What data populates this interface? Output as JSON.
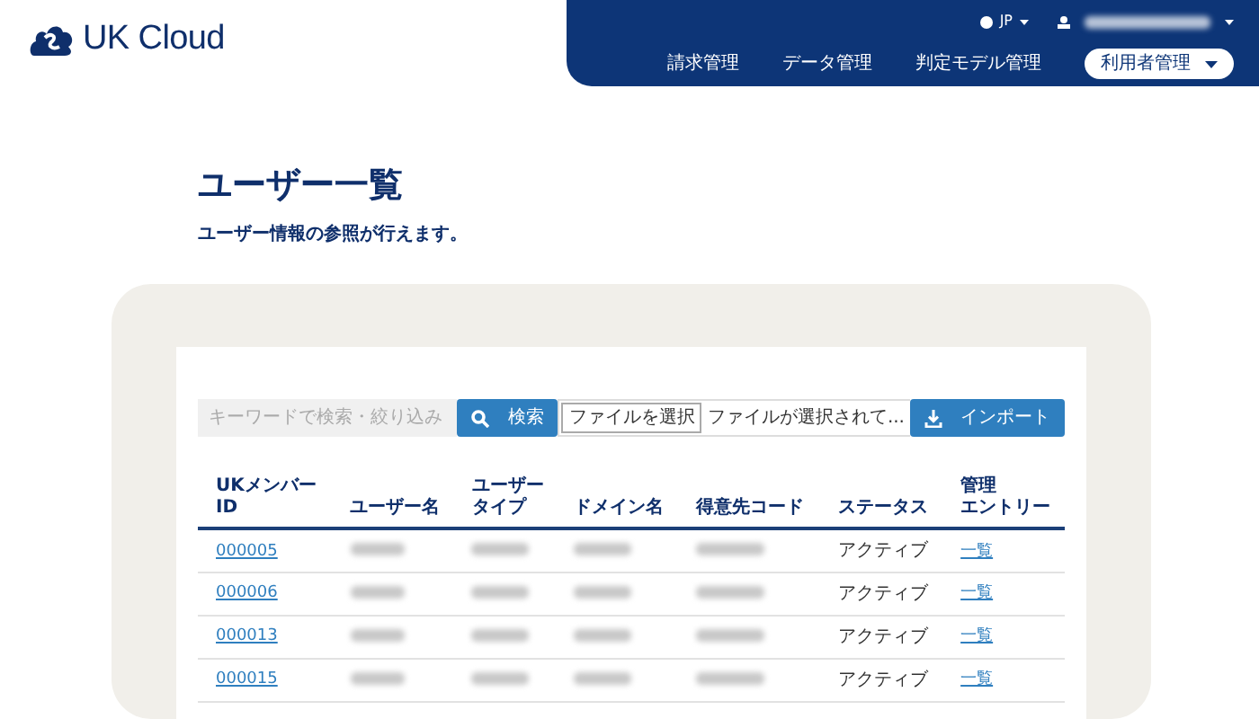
{
  "header": {
    "logo_text": "UK Cloud",
    "language": "JP",
    "nav": [
      {
        "label": "請求管理",
        "kind": "link"
      },
      {
        "label": "データ管理",
        "kind": "link"
      },
      {
        "label": "判定モデル管理",
        "kind": "link"
      },
      {
        "label": "利用者管理",
        "kind": "dropdown"
      }
    ]
  },
  "page": {
    "title": "ユーザー一覧",
    "subtitle": "ユーザー情報の参照が行えます。"
  },
  "toolbar": {
    "search": {
      "placeholder": "キーワードで検索・絞り込み",
      "button": "検索"
    },
    "file": {
      "choose_button": "ファイルを選択",
      "status": "ファイルが選択されて...",
      "import_button": "インポート"
    }
  },
  "table": {
    "columns": [
      {
        "lines": [
          "UKメンバー",
          "ID"
        ]
      },
      {
        "lines": [
          "ユーザー名"
        ]
      },
      {
        "lines": [
          "ユーザー",
          "タイプ"
        ]
      },
      {
        "lines": [
          "ドメイン名"
        ]
      },
      {
        "lines": [
          "得意先コード"
        ]
      },
      {
        "lines": [
          "ステータス"
        ]
      },
      {
        "lines": [
          "管理",
          "エントリー"
        ]
      }
    ],
    "rows": [
      {
        "id": "000005",
        "status": "アクティブ",
        "link": "一覧"
      },
      {
        "id": "000006",
        "status": "アクティブ",
        "link": "一覧"
      },
      {
        "id": "000013",
        "status": "アクティブ",
        "link": "一覧"
      },
      {
        "id": "000015",
        "status": "アクティブ",
        "link": "一覧"
      }
    ]
  }
}
